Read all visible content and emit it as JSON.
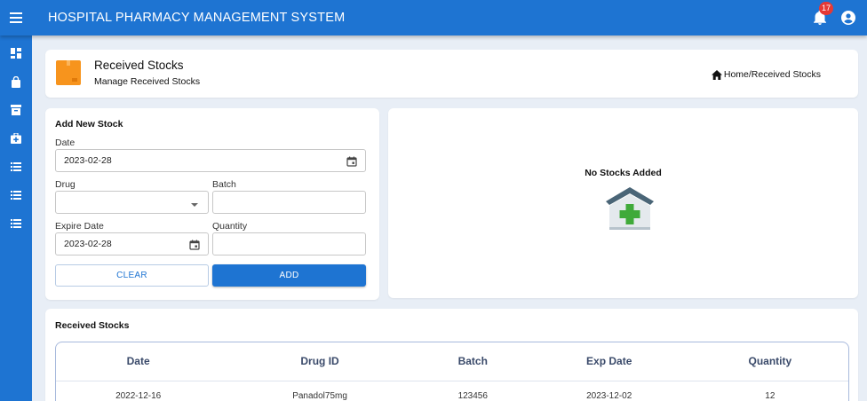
{
  "app": {
    "title": "HOSPITAL PHARMACY MANAGEMENT SYSTEM",
    "notification_count": "17"
  },
  "sidebar": {
    "items": [
      {
        "icon": "dashboard-icon"
      },
      {
        "icon": "shopping-bag-icon"
      },
      {
        "icon": "archive-box-icon"
      },
      {
        "icon": "medical-bag-icon"
      },
      {
        "icon": "list-icon"
      },
      {
        "icon": "list-icon"
      },
      {
        "icon": "list-icon"
      }
    ]
  },
  "header": {
    "title": "Received Stocks",
    "subtitle": "Manage Received Stocks",
    "breadcrumb": "Home/Received Stocks"
  },
  "form": {
    "heading": "Add New Stock",
    "date_label": "Date",
    "date_value": "2023-02-28",
    "drug_label": "Drug",
    "drug_value": "",
    "batch_label": "Batch",
    "batch_value": "",
    "expire_label": "Expire Date",
    "expire_value": "2023-02-28",
    "quantity_label": "Quantity",
    "quantity_value": "",
    "clear_label": "CLEAR",
    "add_label": "ADD"
  },
  "preview": {
    "empty_text": "No Stocks Added"
  },
  "table": {
    "heading": "Received Stocks",
    "columns": [
      "Date",
      "Drug ID",
      "Batch",
      "Exp Date",
      "Quantity"
    ],
    "rows": [
      [
        "2022-12-16",
        "Panadol75mg",
        "123456",
        "2023-12-02",
        "12"
      ]
    ]
  },
  "colors": {
    "primary": "#1e74d2",
    "background": "#e8eef6",
    "badge": "#e53935",
    "icon_orange": "#f7941d",
    "cross_green": "#3faa3a"
  }
}
